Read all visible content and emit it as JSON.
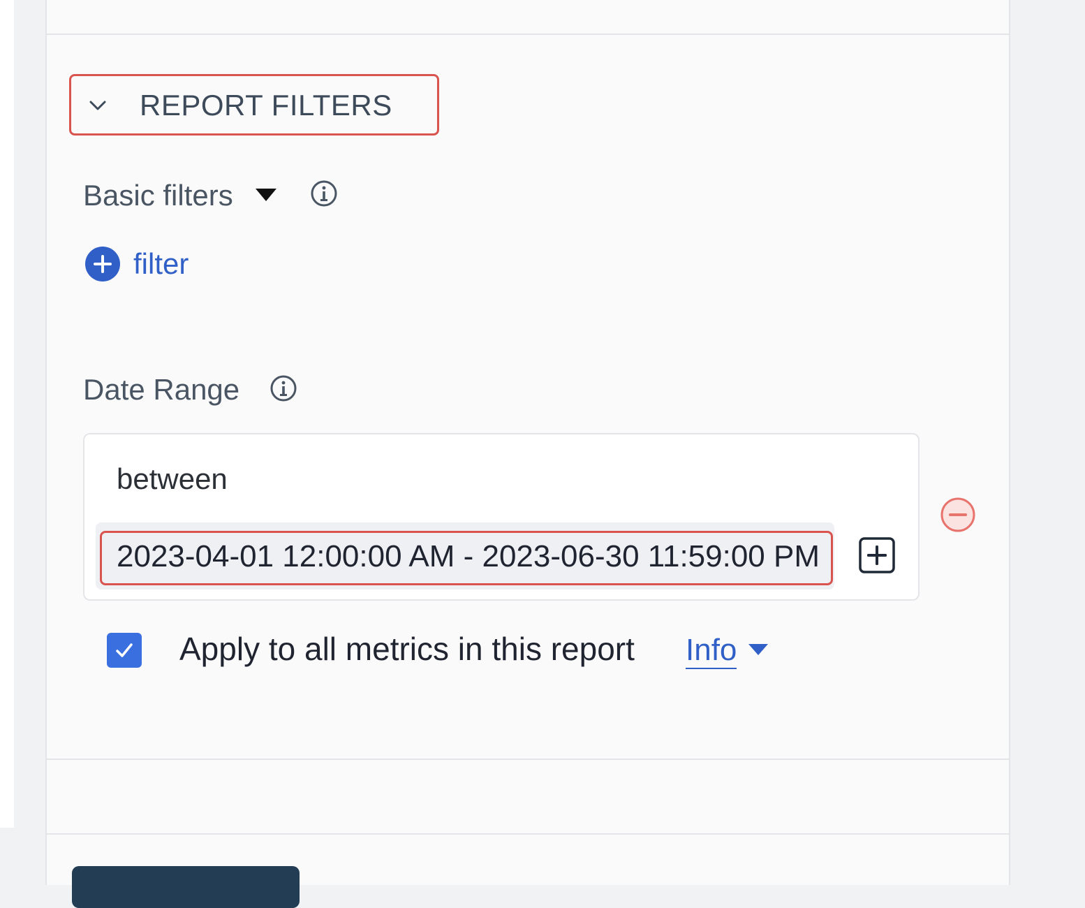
{
  "section": {
    "title": "REPORT FILTERS"
  },
  "basic_filters": {
    "label": "Basic filters",
    "add_filter_label": "filter"
  },
  "date_range": {
    "label": "Date Range",
    "operator": "between",
    "value": "2023-04-01 12:00:00 AM - 2023-06-30 11:59:00 PM"
  },
  "apply_all": {
    "checked": true,
    "label": "Apply to all metrics in this report",
    "info_link": "Info"
  },
  "colors": {
    "accent": "#2f5fc7",
    "checkbox": "#3a6fe0",
    "highlight": "#d9534f",
    "remove": "#e8736d",
    "primary_button": "#233d55"
  }
}
